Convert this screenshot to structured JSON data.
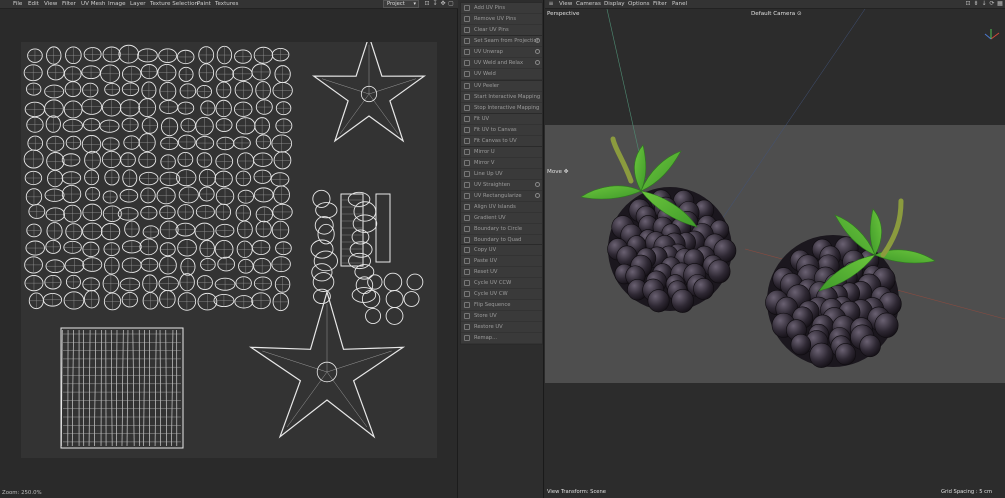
{
  "uv_editor": {
    "menu": [
      "File",
      "Edit",
      "View",
      "Filter",
      "UV Mesh",
      "Image",
      "Layer",
      "Texture Selection",
      "Paint",
      "Textures"
    ],
    "project_select": "Project",
    "status": "Zoom: 250.0%",
    "icons": [
      "lock-icon",
      "download-icon",
      "move-icon",
      "frame-icon"
    ]
  },
  "commands": {
    "groups": [
      [
        "Add UV Pins",
        "Remove UV Pins",
        "Clear UV Pins"
      ],
      [
        "Set Seam from Projection",
        "UV Unwrap",
        "UV Weld and Relax",
        "UV Weld"
      ],
      [
        "UV Peeler",
        "Start Interactive Mapping",
        "Stop Interactive Mapping"
      ],
      [
        "Fit UV",
        "Fit UV to Canvas",
        "Fit Canvas to UV"
      ],
      [
        "Mirror U",
        "Mirror V",
        "Line Up UV",
        "UV Straighten",
        "UV Rectangularize",
        "Align UV Islands",
        "Gradient UV",
        "Boundary to Circle",
        "Boundary to Quad"
      ],
      [
        "Copy UV",
        "Paste UV",
        "Reset UV",
        "Cycle UV CCW",
        "Cycle UV CW",
        "Flip Sequence",
        "Store UV",
        "Restore UV",
        "Remap..."
      ]
    ]
  },
  "viewport": {
    "menu": [
      "View",
      "Cameras",
      "Display",
      "Options",
      "Filter",
      "Panel"
    ],
    "label_perspective": "Perspective",
    "label_camera": "Default Camera",
    "camera_glyph": "⊙",
    "label_move": "Move",
    "move_glyph": "✥",
    "footer_left": "View Transform: Scene",
    "footer_right": "Grid Spacing : 5 cm",
    "icons": [
      "maximize-icon",
      "minimize-icon",
      "arrow-down-icon",
      "sync-icon",
      "grid-icon"
    ]
  },
  "colors": {
    "berry": "#2e2833",
    "berry_highlight": "#6a6172",
    "leaf": "#3f9a2a",
    "leaf_light": "#6cc63d",
    "stem": "#8b9b3e",
    "uv_line": "#e8e8e8",
    "ground": "#4e4e4e"
  }
}
